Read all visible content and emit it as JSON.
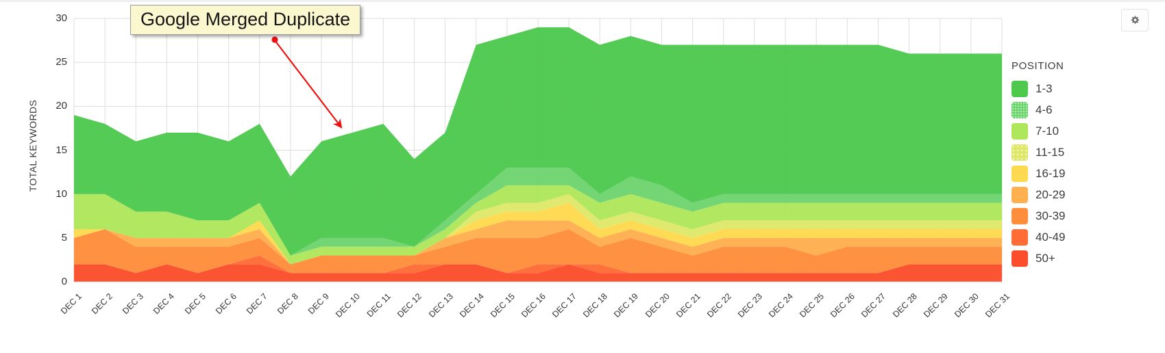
{
  "toolbar": {
    "settings_label": "settings",
    "settings_icon": "gear-icon"
  },
  "annotation": {
    "text": "Google Merged Duplicate",
    "arrow_color": "#ee1111"
  },
  "legend": {
    "title": "POSITION",
    "items": [
      {
        "label": "1-3",
        "color": "#4ec94e"
      },
      {
        "label": "4-6",
        "color": "#6ed46e"
      },
      {
        "label": "7-10",
        "color": "#aee65c"
      },
      {
        "label": "11-15",
        "color": "#dfe86a"
      },
      {
        "label": "16-19",
        "color": "#ffd94f"
      },
      {
        "label": "20-29",
        "color": "#ffb04f"
      },
      {
        "label": "30-39",
        "color": "#ff8e3c"
      },
      {
        "label": "40-49",
        "color": "#ff6c36"
      },
      {
        "label": "50+",
        "color": "#fb4e2c"
      }
    ]
  },
  "chart_data": {
    "type": "area",
    "title": "",
    "xlabel": "",
    "ylabel": "TOTAL KEYWORDS",
    "ylim": [
      0,
      30
    ],
    "yticks": [
      0,
      5,
      10,
      15,
      20,
      25,
      30
    ],
    "grid": true,
    "legend_position": "right",
    "stacked": true,
    "categories": [
      "DEC 1",
      "DEC 2",
      "DEC 3",
      "DEC 4",
      "DEC 5",
      "DEC 6",
      "DEC 7",
      "DEC 8",
      "DEC 9",
      "DEC 10",
      "DEC 11",
      "DEC 12",
      "DEC 13",
      "DEC 14",
      "DEC 15",
      "DEC 16",
      "DEC 17",
      "DEC 18",
      "DEC 19",
      "DEC 20",
      "DEC 21",
      "DEC 22",
      "DEC 23",
      "DEC 24",
      "DEC 25",
      "DEC 26",
      "DEC 27",
      "DEC 28",
      "DEC 29",
      "DEC 30",
      "DEC 31"
    ],
    "series": [
      {
        "name": "50+",
        "color": "#fb4e2c",
        "values": [
          2,
          2,
          1,
          2,
          1,
          2,
          2,
          1,
          1,
          1,
          1,
          1,
          2,
          2,
          1,
          1,
          2,
          1,
          1,
          1,
          1,
          1,
          1,
          1,
          1,
          1,
          1,
          2,
          2,
          2,
          2
        ]
      },
      {
        "name": "40-49",
        "color": "#ff6c36",
        "values": [
          0,
          0,
          0,
          0,
          0,
          0,
          1,
          0,
          0,
          0,
          0,
          1,
          0,
          0,
          0,
          1,
          0,
          1,
          0,
          0,
          0,
          0,
          0,
          0,
          0,
          0,
          0,
          0,
          0,
          0,
          0
        ]
      },
      {
        "name": "30-39",
        "color": "#ff8e3c",
        "values": [
          3,
          4,
          3,
          2,
          3,
          2,
          2,
          1,
          2,
          2,
          2,
          1,
          2,
          3,
          4,
          3,
          4,
          2,
          4,
          3,
          2,
          3,
          3,
          3,
          2,
          3,
          3,
          2,
          2,
          2,
          2
        ]
      },
      {
        "name": "20-29",
        "color": "#ffb04f",
        "values": [
          0,
          0,
          1,
          1,
          1,
          1,
          1,
          0,
          0,
          0,
          0,
          0,
          1,
          1,
          2,
          2,
          1,
          1,
          1,
          1,
          1,
          1,
          1,
          1,
          2,
          1,
          1,
          1,
          1,
          1,
          1
        ]
      },
      {
        "name": "16-19",
        "color": "#ffd94f",
        "values": [
          1,
          0,
          0,
          0,
          0,
          0,
          1,
          0,
          0,
          0,
          0,
          0,
          0,
          1,
          1,
          1,
          2,
          1,
          1,
          1,
          1,
          1,
          1,
          1,
          1,
          1,
          1,
          1,
          1,
          1,
          1
        ]
      },
      {
        "name": "11-15",
        "color": "#dfe86a",
        "values": [
          0,
          0,
          0,
          0,
          0,
          0,
          0,
          0,
          0,
          0,
          0,
          0,
          0,
          1,
          1,
          1,
          1,
          1,
          1,
          1,
          1,
          1,
          1,
          1,
          1,
          1,
          1,
          1,
          1,
          1,
          1
        ]
      },
      {
        "name": "7-10",
        "color": "#aee65c",
        "values": [
          4,
          4,
          3,
          3,
          2,
          2,
          2,
          1,
          1,
          1,
          1,
          1,
          1,
          1,
          2,
          2,
          1,
          2,
          2,
          2,
          2,
          2,
          2,
          2,
          2,
          2,
          2,
          2,
          2,
          2,
          2
        ]
      },
      {
        "name": "4-6",
        "color": "#6ed46e",
        "values": [
          0,
          0,
          0,
          0,
          0,
          0,
          0,
          0,
          1,
          1,
          1,
          0,
          1,
          1,
          2,
          2,
          2,
          1,
          2,
          2,
          1,
          1,
          1,
          1,
          1,
          1,
          1,
          1,
          1,
          1,
          1
        ]
      },
      {
        "name": "1-3",
        "color": "#4ec94e",
        "values": [
          9,
          8,
          8,
          9,
          10,
          9,
          9,
          9,
          11,
          12,
          13,
          10,
          10,
          17,
          15,
          16,
          16,
          17,
          16,
          16,
          18,
          17,
          17,
          17,
          17,
          17,
          17,
          16,
          16,
          16,
          16
        ]
      }
    ],
    "totals": [
      19,
      18,
      16,
      17,
      17,
      16,
      18,
      12,
      15,
      16,
      18,
      14,
      16,
      27,
      28,
      29,
      29,
      27,
      28,
      27,
      27,
      27,
      27,
      27,
      27,
      27,
      27,
      26,
      26,
      26,
      26
    ]
  }
}
